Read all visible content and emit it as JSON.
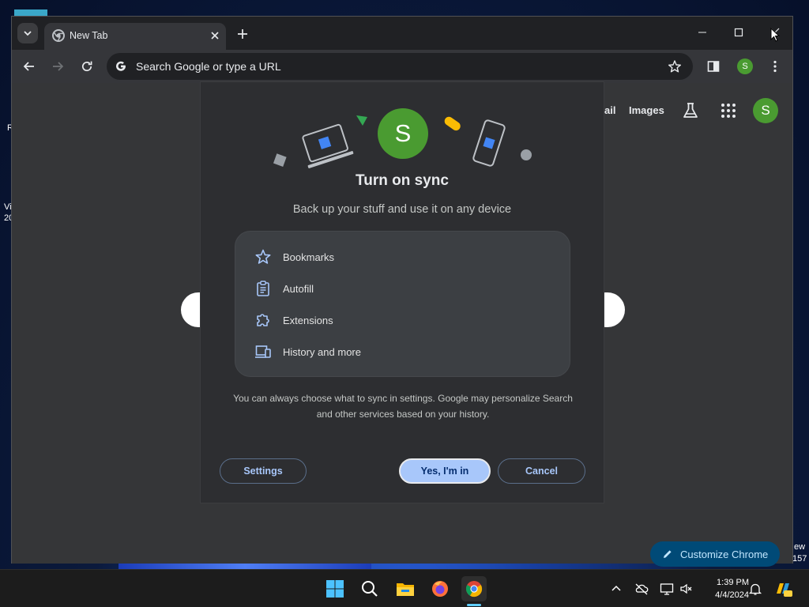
{
  "browser": {
    "tab": {
      "title": "New Tab"
    },
    "omnibox": {
      "placeholder": "Search Google or type a URL"
    },
    "profile_initial": "S"
  },
  "ntp": {
    "links": {
      "mail_partial": "ail",
      "images": "Images"
    },
    "avatar_initial": "S",
    "customize_label": "Customize Chrome"
  },
  "sync_dialog": {
    "avatar_initial": "S",
    "title": "Turn on sync",
    "subtitle": "Back up your stuff and use it on any device",
    "features": [
      {
        "label": "Bookmarks",
        "icon": "star-icon"
      },
      {
        "label": "Autofill",
        "icon": "clipboard-icon"
      },
      {
        "label": "Extensions",
        "icon": "puzzle-icon"
      },
      {
        "label": "History and more",
        "icon": "devices-icon"
      }
    ],
    "note": "You can always choose what to sync in settings. Google may personalize Search and other services based on your history.",
    "buttons": {
      "settings": "Settings",
      "confirm": "Yes, I'm in",
      "cancel": "Cancel"
    }
  },
  "desktop": {
    "fragments": [
      "R",
      "Vi",
      "20",
      "ew",
      "157"
    ]
  },
  "taskbar": {
    "time": "1:39 PM",
    "date": "4/4/2024",
    "apps": [
      "start-icon",
      "search-icon",
      "file-explorer-icon",
      "firefox-icon",
      "chrome-icon"
    ],
    "tray": [
      "chevron-up-icon",
      "onedrive-icon",
      "display-icon",
      "volume-icon",
      "bell-icon",
      "copilot-icon"
    ]
  },
  "colors": {
    "accent": "#a8c7fa",
    "profile_green": "#4a9b31",
    "dialog_bg": "#2d2e31",
    "customize_bg": "#004a77"
  }
}
